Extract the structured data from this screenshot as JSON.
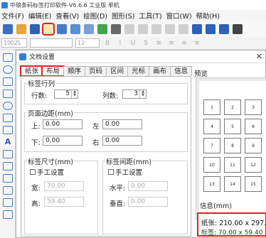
{
  "app": {
    "title": "中琅条码标签打印软件-V6.6.6 工业版 单机"
  },
  "menu": [
    "文件(F)",
    "编辑(E)",
    "查看(V)",
    "绘图(D)",
    "图形(S)",
    "工具(T)",
    "窗口(W)",
    "帮助(H)"
  ],
  "format_bar": {
    "zoom": "100ZL",
    "font_size": "12"
  },
  "dialog": {
    "title": "文档设置",
    "tabs": [
      "纸张",
      "布局",
      "顺序",
      "页码",
      "区间",
      "光标",
      "画布",
      "信息"
    ],
    "active_tab": "布局",
    "label_rows_cols": {
      "group": "标签行列",
      "rows_label": "行数:",
      "rows_value": "5",
      "cols_label": "列数:",
      "cols_value": "3"
    },
    "page_margin": {
      "group": "页面边距(mm)",
      "top_label": "上:",
      "top_value": "0.00",
      "left_label": "左",
      "left_value": "0.00",
      "bottom_label": "下:",
      "bottom_value": "0.00",
      "right_label": "右",
      "right_value": "0.00"
    },
    "label_size": {
      "group": "标签尺寸(mm)",
      "manual_label": "手工设置",
      "width_label": "宽:",
      "width_value": "70.00",
      "height_label": "高:",
      "height_value": "59.40"
    },
    "label_spacing": {
      "group": "标签间距(mm)",
      "manual_label": "手工设置",
      "h_label": "水平:",
      "h_value": "0.00",
      "v_label": "垂直:",
      "v_value": "0.00"
    },
    "preview": {
      "title": "预览",
      "cells": [
        "1",
        "2",
        "3",
        "4",
        "5",
        "6",
        "7",
        "8",
        "9",
        "10",
        "11",
        "12",
        "13",
        "14",
        "15"
      ]
    },
    "info": {
      "title": "信息(mm)",
      "paper": "纸张: 210.00 x 297.00",
      "label": "标签: 70.00 x 59.40"
    }
  }
}
